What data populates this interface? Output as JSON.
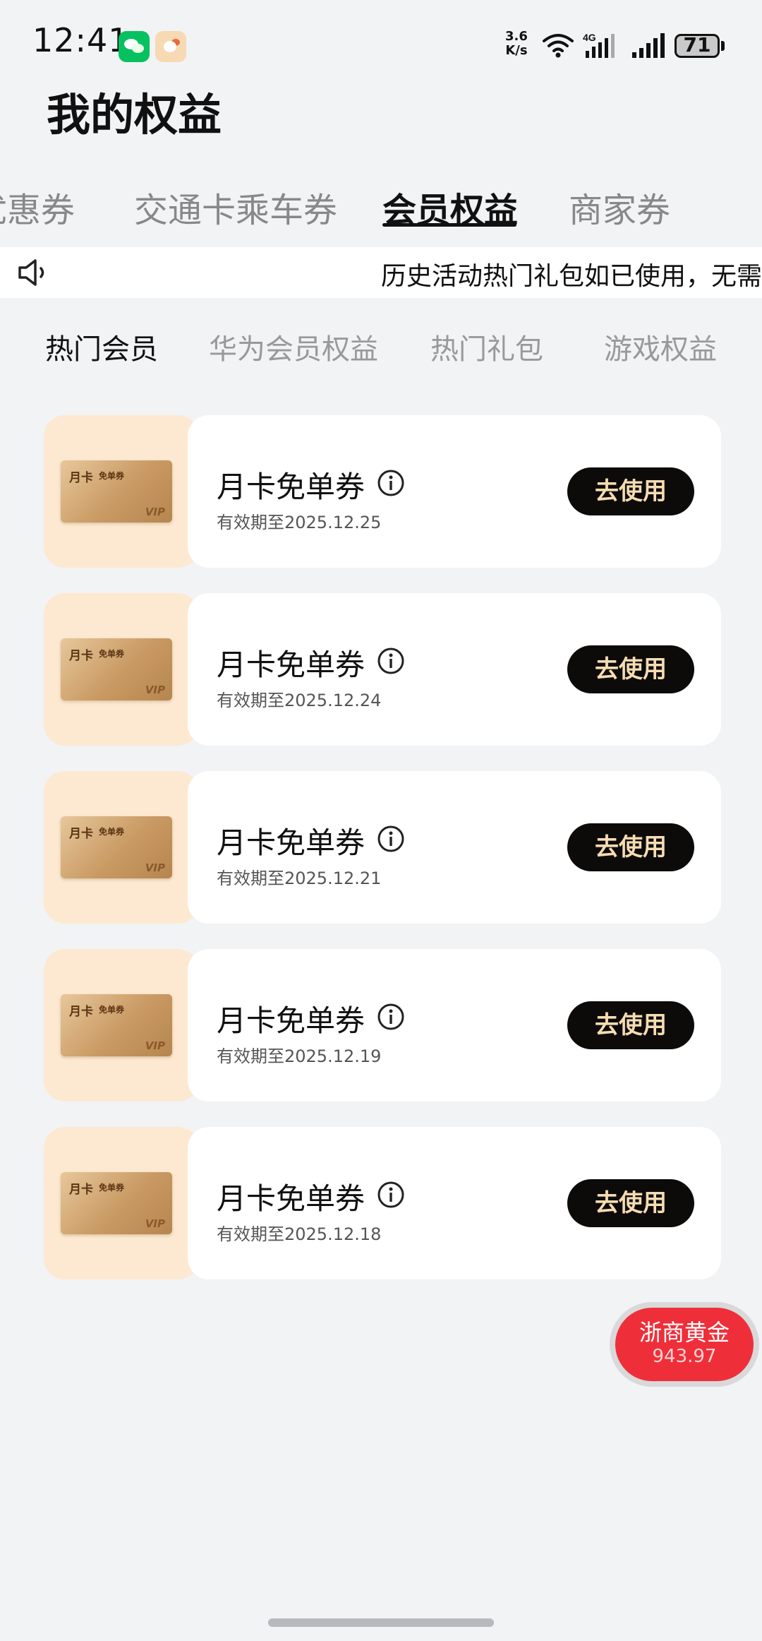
{
  "status_bar": {
    "time": "12:41",
    "net_speed_value": "3.6",
    "net_speed_unit": "K/s",
    "network": "4G",
    "battery": "71"
  },
  "page": {
    "title": "我的权益"
  },
  "main_tabs": [
    {
      "label": "优惠券",
      "active": false
    },
    {
      "label": "交通卡乘车券",
      "active": false
    },
    {
      "label": "会员权益",
      "active": true
    },
    {
      "label": "商家券",
      "active": false
    }
  ],
  "notice": {
    "text": "历史活动热门礼包如已使用，无需"
  },
  "sub_tabs": [
    {
      "label": "热门会员",
      "active": true
    },
    {
      "label": "华为会员权益",
      "active": false
    },
    {
      "label": "热门礼包",
      "active": false
    },
    {
      "label": "游戏权益",
      "active": false
    }
  ],
  "coupons": [
    {
      "title": "月卡免单券",
      "validity": "有效期至2025.12.25",
      "button": "去使用",
      "card_text_1": "月卡",
      "card_text_2": "免单券",
      "card_text_3": "VIP"
    },
    {
      "title": "月卡免单券",
      "validity": "有效期至2025.12.24",
      "button": "去使用",
      "card_text_1": "月卡",
      "card_text_2": "免单券",
      "card_text_3": "VIP"
    },
    {
      "title": "月卡免单券",
      "validity": "有效期至2025.12.21",
      "button": "去使用",
      "card_text_1": "月卡",
      "card_text_2": "免单券",
      "card_text_3": "VIP"
    },
    {
      "title": "月卡免单券",
      "validity": "有效期至2025.12.19",
      "button": "去使用",
      "card_text_1": "月卡",
      "card_text_2": "免单券",
      "card_text_3": "VIP"
    },
    {
      "title": "月卡免单券",
      "validity": "有效期至2025.12.18",
      "button": "去使用",
      "card_text_1": "月卡",
      "card_text_2": "免单券",
      "card_text_3": "VIP"
    }
  ],
  "floating_widget": {
    "name": "浙商黄金",
    "price": "943.97"
  },
  "colors": {
    "accent_button": "#0d0b0a",
    "button_text": "#f6dcb1",
    "thumb_bg": "#fde9d1",
    "widget_red": "#ee2f3a"
  }
}
